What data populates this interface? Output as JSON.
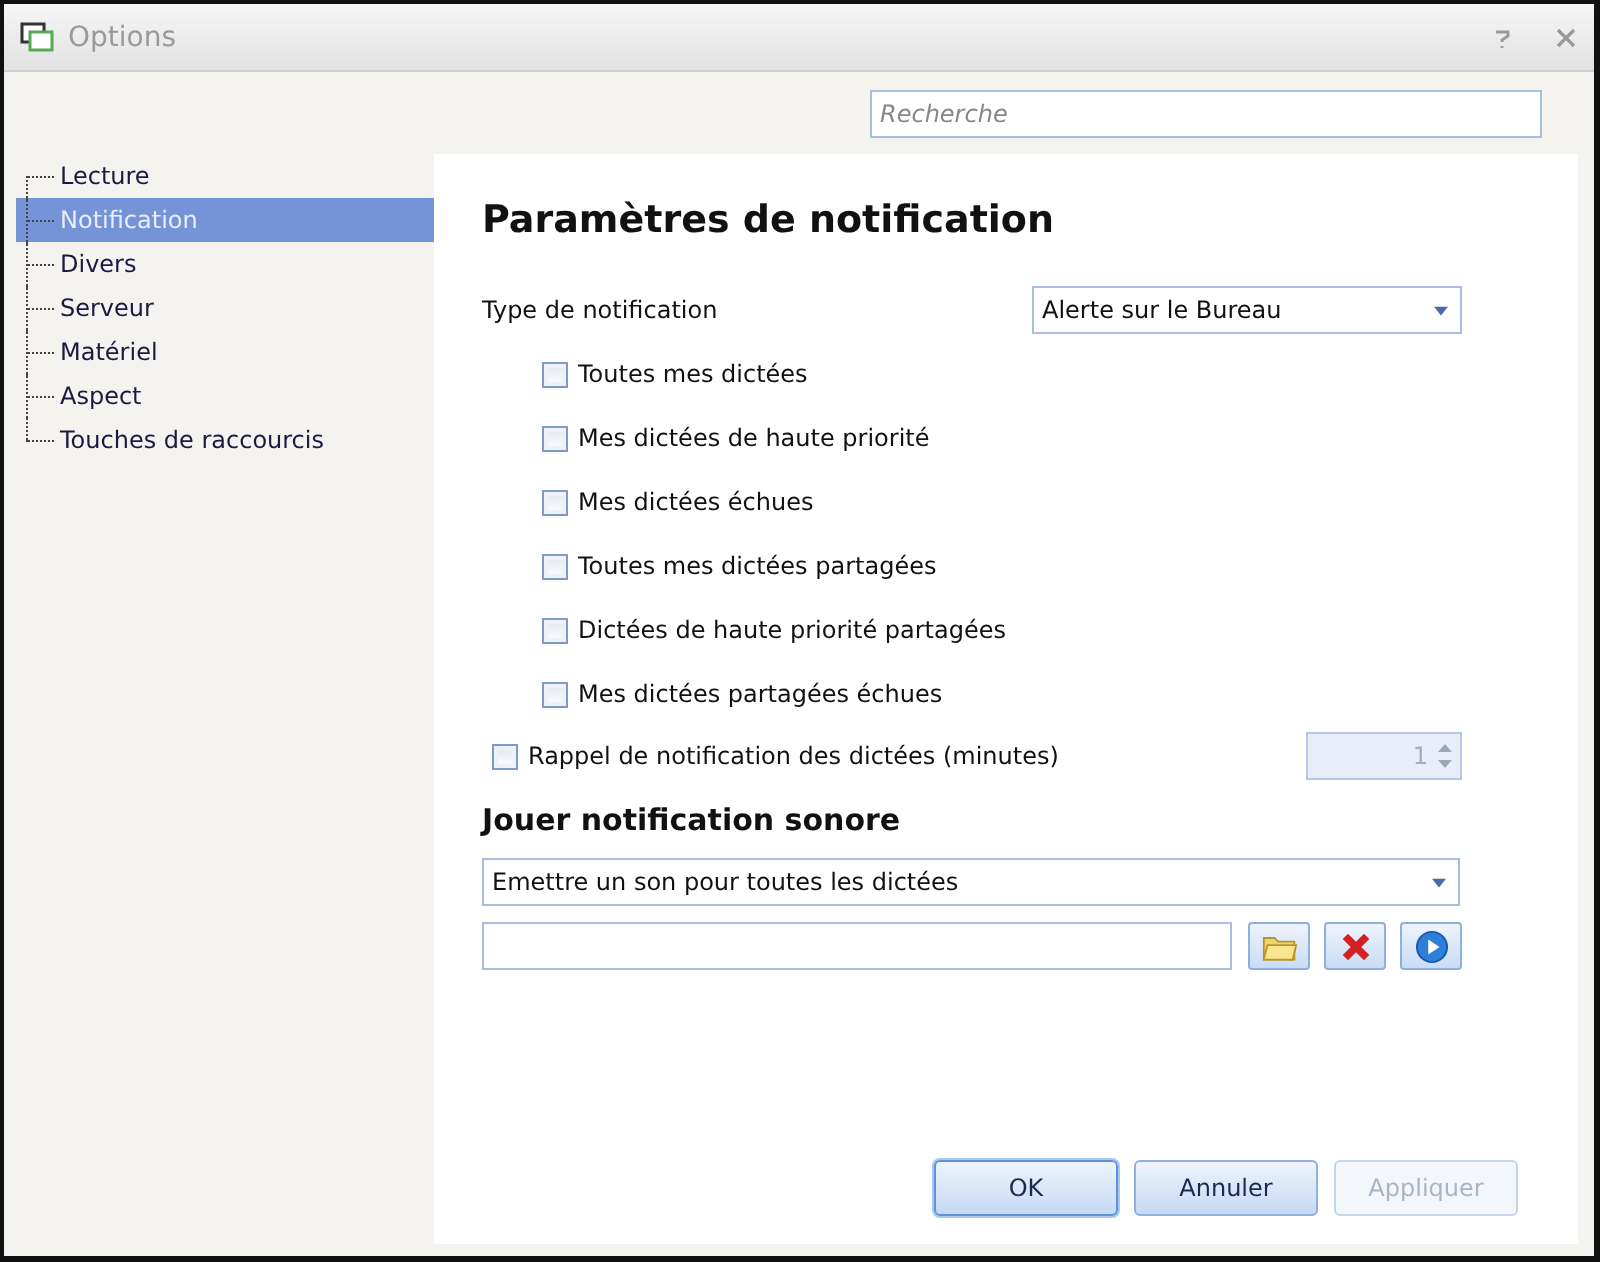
{
  "window": {
    "title": "Options"
  },
  "search": {
    "placeholder": "Recherche"
  },
  "sidebar": {
    "items": [
      {
        "label": "Lecture",
        "selected": false
      },
      {
        "label": "Notification",
        "selected": true
      },
      {
        "label": "Divers",
        "selected": false
      },
      {
        "label": "Serveur",
        "selected": false
      },
      {
        "label": "Matériel",
        "selected": false
      },
      {
        "label": "Aspect",
        "selected": false
      },
      {
        "label": "Touches de raccourcis",
        "selected": false
      }
    ]
  },
  "panel": {
    "title": "Paramètres de notification",
    "type_label": "Type de notification",
    "type_value": "Alerte sur le Bureau",
    "options": [
      {
        "label": "Toutes mes dictées",
        "checked": false
      },
      {
        "label": "Mes dictées de haute priorité",
        "checked": false
      },
      {
        "label": "Mes dictées échues",
        "checked": false
      },
      {
        "label": "Toutes mes dictées partagées",
        "checked": false
      },
      {
        "label": "Dictées de haute priorité partagées",
        "checked": false
      },
      {
        "label": "Mes dictées partagées échues",
        "checked": false
      }
    ],
    "reminder": {
      "label": "Rappel de notification des dictées (minutes)",
      "checked": false,
      "value": "1",
      "disabled": true
    },
    "sound_heading": "Jouer notification sonore",
    "sound_value": "Emettre un son  pour toutes les dictées"
  },
  "buttons": [
    {
      "label": "OK",
      "disabled": false,
      "default": true
    },
    {
      "label": "Annuler",
      "disabled": false,
      "default": false
    },
    {
      "label": "Appliquer",
      "disabled": true,
      "default": false
    }
  ]
}
